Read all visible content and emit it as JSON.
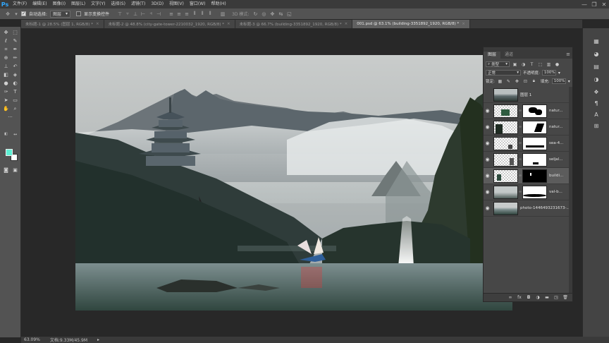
{
  "app": {
    "logo": "Ps"
  },
  "menu": [
    "文件(F)",
    "编辑(E)",
    "图像(I)",
    "图层(L)",
    "文字(Y)",
    "选择(S)",
    "滤镜(T)",
    "3D(D)",
    "视图(V)",
    "窗口(W)",
    "帮助(H)"
  ],
  "window_controls": {
    "minimize": "—",
    "restore": "❐",
    "close": "✕"
  },
  "options": {
    "auto_select_label": "自动选择:",
    "auto_select_target": "图层",
    "show_transform_label": "显示变换控件",
    "mode3d_label": "3D 模式:"
  },
  "tabs": [
    {
      "label": "未标题-1 @ 28.5% (图层 1, RGB/8) *",
      "active": false
    },
    {
      "label": "未标题-2 @ 48.8% (city-gate-tower-2210032_1920, RGB/8) *",
      "active": false
    },
    {
      "label": "未标题-3 @ 66.7% (building-3351892_1920, RGB/8) *",
      "active": false
    },
    {
      "label": "001.psd @ 63.1% (building-3351892_1920, RGB/8) *",
      "active": true
    }
  ],
  "layers_panel": {
    "tabs": [
      "图层",
      "通道"
    ],
    "filter_kind": "类型",
    "blend_mode": "正常",
    "opacity_label": "不透明度:",
    "opacity_value": "100%",
    "lock_label": "锁定:",
    "fill_label": "填充:",
    "fill_value": "100%",
    "layers": [
      {
        "name": "图层 1",
        "visible": false,
        "has_mask": false,
        "selected": false
      },
      {
        "name": "natur...",
        "visible": true,
        "has_mask": true,
        "selected": false
      },
      {
        "name": "natur...",
        "visible": true,
        "has_mask": true,
        "selected": false
      },
      {
        "name": "sea-4...",
        "visible": true,
        "has_mask": true,
        "selected": false
      },
      {
        "name": "seljal...",
        "visible": true,
        "has_mask": true,
        "selected": false
      },
      {
        "name": "buildi...",
        "visible": true,
        "has_mask": true,
        "selected": true
      },
      {
        "name": "val-b...",
        "visible": true,
        "has_mask": true,
        "selected": false
      },
      {
        "name": "photo-1446493231673-...",
        "visible": true,
        "has_mask": false,
        "selected": false
      }
    ],
    "footer_icons": [
      "link-icon",
      "fx-icon",
      "add-mask-icon",
      "adjustment-icon",
      "group-folder-icon",
      "new-layer-icon",
      "trash-icon"
    ]
  },
  "status": {
    "zoom": "63.09%",
    "doc_size": "文档:9.33M/45.9M"
  }
}
